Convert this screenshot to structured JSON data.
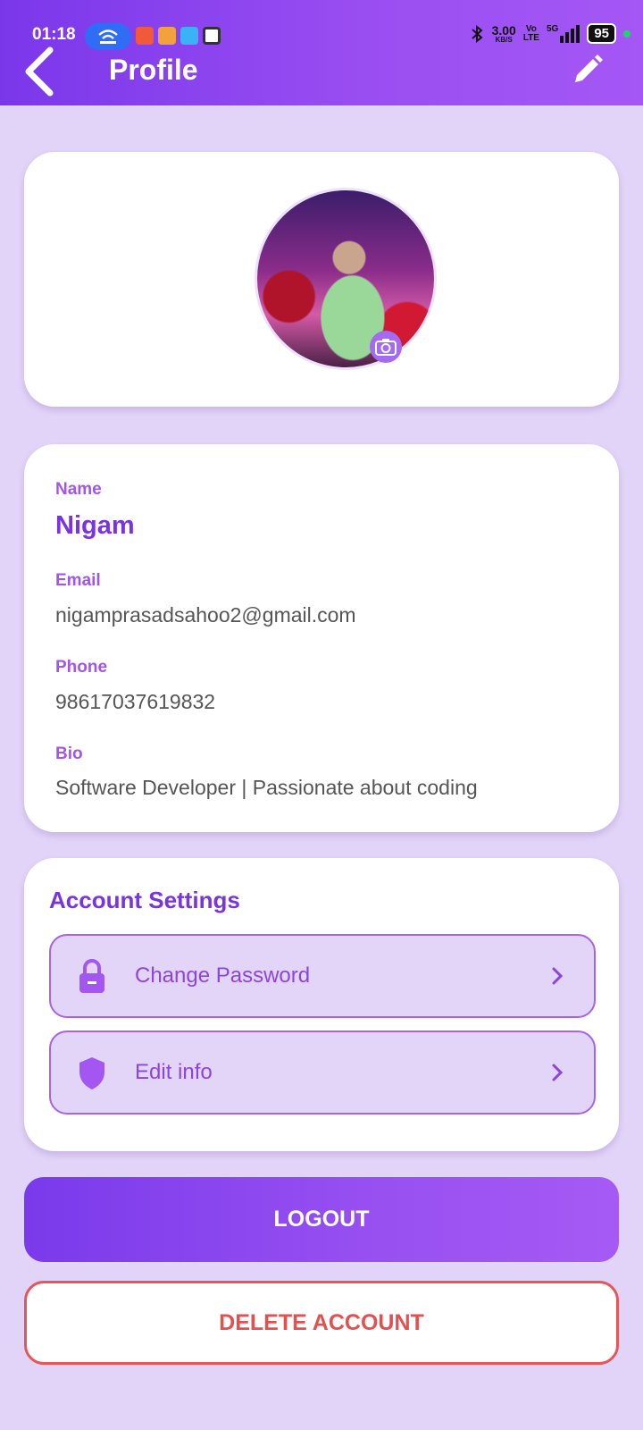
{
  "status_bar": {
    "time": "01:18",
    "net_speed_value": "3.00",
    "net_speed_unit": "KB/S",
    "volte_top": "Vo",
    "volte_bottom": "LTE",
    "network": "5G",
    "battery": "95"
  },
  "header": {
    "title": "Profile"
  },
  "profile": {
    "name_label": "Name",
    "name": "Nigam",
    "email_label": "Email",
    "email": "nigamprasadsahoo2@gmail.com",
    "phone_label": "Phone",
    "phone": "98617037619832",
    "bio_label": "Bio",
    "bio": "Software Developer | Passionate about coding"
  },
  "account_settings": {
    "title": "Account Settings",
    "items": [
      {
        "label": "Change Password",
        "icon": "lock-icon"
      },
      {
        "label": "Edit info",
        "icon": "shield-icon"
      }
    ]
  },
  "actions": {
    "logout": "LOGOUT",
    "delete_account": "DELETE ACCOUNT"
  },
  "colors": {
    "accent": "#7a33e0",
    "label": "#a255e8",
    "background": "#e2d4f8",
    "danger": "#e45050"
  }
}
